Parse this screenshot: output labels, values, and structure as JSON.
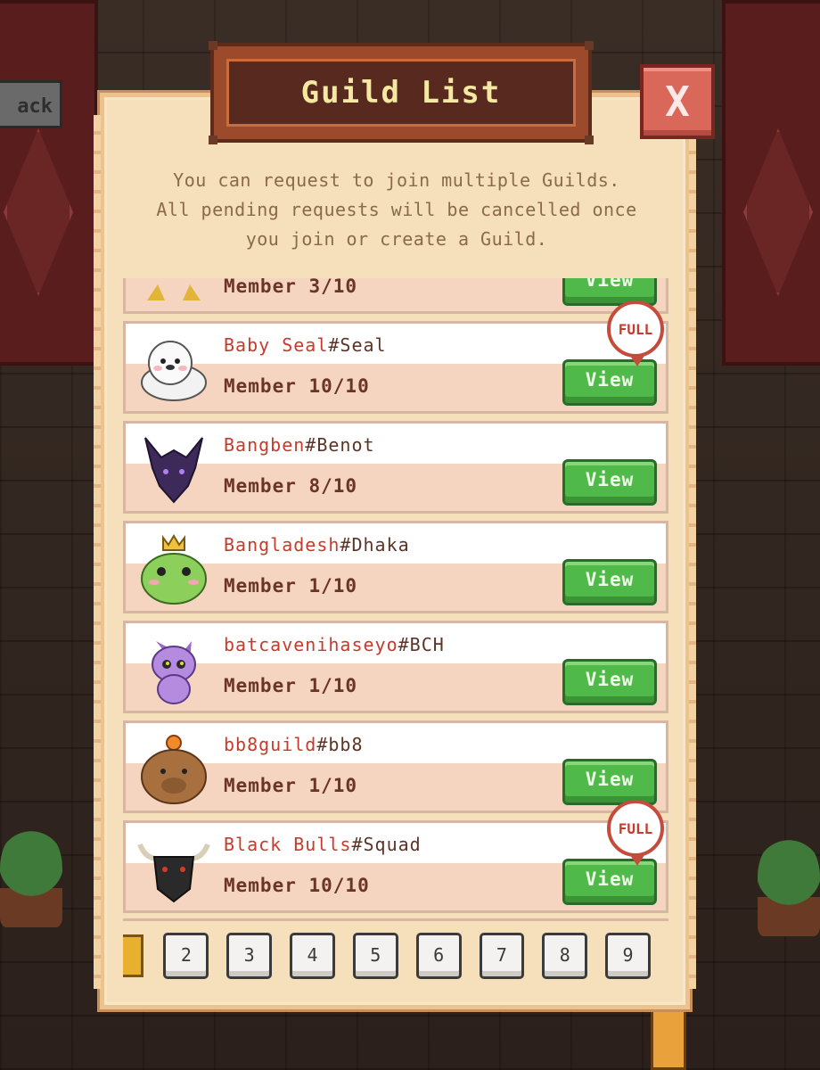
{
  "dialog": {
    "title": "Guild List",
    "close_label": "X",
    "info_lines": [
      "You can request to join multiple Guilds.",
      "All pending requests will be cancelled once",
      "you join or create a Guild."
    ]
  },
  "guilds": [
    {
      "name": "",
      "tag": "",
      "member": "Member 3/10",
      "view_label": "View",
      "full": false,
      "avatar_icon": "partial-guild-icon"
    },
    {
      "name": "Baby Seal",
      "tag": "#Seal",
      "member": "Member 10/10",
      "view_label": "View",
      "full": true,
      "badge": "FULL",
      "avatar_icon": "seal-icon"
    },
    {
      "name": "Bangben",
      "tag": "#Benot",
      "member": "Member 8/10",
      "view_label": "View",
      "full": false,
      "avatar_icon": "dragon-icon"
    },
    {
      "name": "Bangladesh",
      "tag": "#Dhaka",
      "member": "Member 1/10",
      "view_label": "View",
      "full": false,
      "avatar_icon": "frog-king-icon"
    },
    {
      "name": "batcavenihaseyo",
      "tag": "#BCH",
      "member": "Member 1/10",
      "view_label": "View",
      "full": false,
      "avatar_icon": "purple-dragon-icon"
    },
    {
      "name": "bb8guild",
      "tag": "#bb8",
      "member": "Member 1/10",
      "view_label": "View",
      "full": false,
      "avatar_icon": "capybara-icon"
    },
    {
      "name": "Black Bulls",
      "tag": "#Squad",
      "member": "Member 10/10",
      "view_label": "View",
      "full": true,
      "badge": "FULL",
      "avatar_icon": "bull-icon"
    }
  ],
  "pagination": {
    "pages": [
      "2",
      "3",
      "4",
      "5",
      "6",
      "7",
      "8",
      "9"
    ]
  },
  "colors": {
    "accent_green": "#4fb94a",
    "name_red": "#c63b2c",
    "panel_bg": "#f6dfbb",
    "close_red": "#d9685a"
  }
}
